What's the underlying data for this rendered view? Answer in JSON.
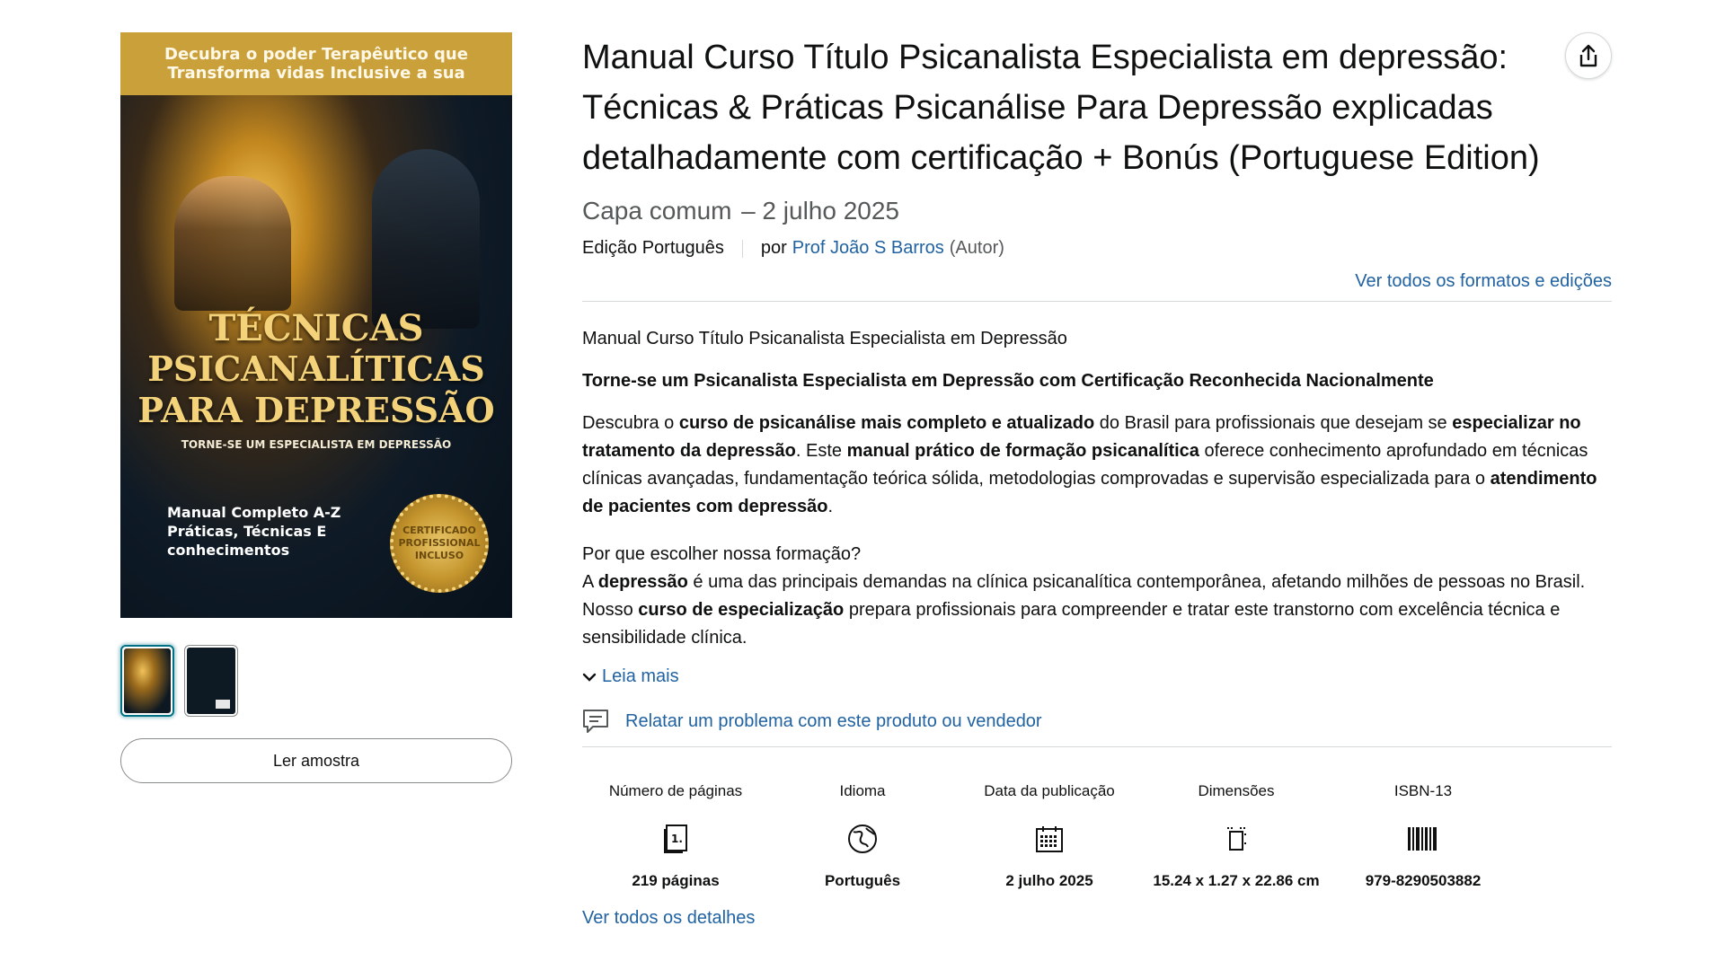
{
  "cover": {
    "banner": "Decubra o poder Terapêutico que Transforma vidas Inclusive a sua",
    "title_line1": "TÉCNICAS",
    "title_line2": "PSICANALÍTICAS",
    "title_line3": "PARA DEPRESSÃO",
    "subtitle": "TORNE-SE UM ESPECIALISTA EM DEPRESSÃO",
    "features": "Manual Completo A-Z Práticas, Técnicas E conhecimentos",
    "seal": "CERTIFICADO PROFISSIONAL INCLUSO"
  },
  "gallery": {
    "sample_button": "Ler amostra"
  },
  "product": {
    "title": "Manual Curso Título Psicanalista Especialista em depressão: Técnicas & Práticas Psicanálise Para Depressão explicadas detalhadamente com certificação + Bonús (Portuguese Edition)",
    "binding": "Capa comum",
    "date": "– 2 julho 2025",
    "edition": "Edição Português",
    "by": "por",
    "author": "Prof João S Barros",
    "author_role": "(Autor)",
    "formats_link": "Ver todos os formatos e edições"
  },
  "description": {
    "line1": "Manual Curso Título Psicanalista Especialista em Depressão",
    "headline": "Torne-se um Psicanalista Especialista em Depressão com Certificação Reconhecida Nacionalmente",
    "p1_a": "Descubra o ",
    "p1_b": "curso de psicanálise mais completo e atualizado",
    "p1_c": " do Brasil para profissionais que desejam se ",
    "p1_d": "especializar no tratamento da depressão",
    "p1_e": ". Este ",
    "p1_f": "manual prático de formação psicanalítica",
    "p1_g": " oferece conhecimento aprofundado em técnicas clínicas avançadas, fundamentação teórica sólida, metodologias comprovadas e supervisão especializada para o ",
    "p1_h": "atendimento de pacientes com depressão",
    "p1_i": ".",
    "q": "Por que escolher nossa formação?",
    "p2_a": "A ",
    "p2_b": "depressão",
    "p2_c": " é uma das principais demandas na clínica psicanalítica contemporânea, afetando milhões de pessoas no Brasil. Nosso ",
    "p2_d": "curso de especialização",
    "p2_e": " prepara profissionais para compreender e tratar este transtorno com excelência técnica e sensibilidade clínica.",
    "read_more": "Leia mais",
    "report": "Relatar um problema com este produto ou vendedor"
  },
  "details": [
    {
      "label": "Número de páginas",
      "icon": "book-pages-icon",
      "value": "219 páginas"
    },
    {
      "label": "Idioma",
      "icon": "globe-icon",
      "value": "Português"
    },
    {
      "label": "Data da publicação",
      "icon": "calendar-icon",
      "value": "2 julho 2025"
    },
    {
      "label": "Dimensões",
      "icon": "dimensions-icon",
      "value": "15.24 x 1.27 x 22.86 cm"
    },
    {
      "label": "ISBN-13",
      "icon": "barcode-icon",
      "value": "979-8290503882"
    }
  ],
  "all_details_link": "Ver todos os detalhes",
  "colors": {
    "link": "#2162a1",
    "text": "#0f1111",
    "muted": "#565959",
    "border": "#d5d9d9"
  }
}
